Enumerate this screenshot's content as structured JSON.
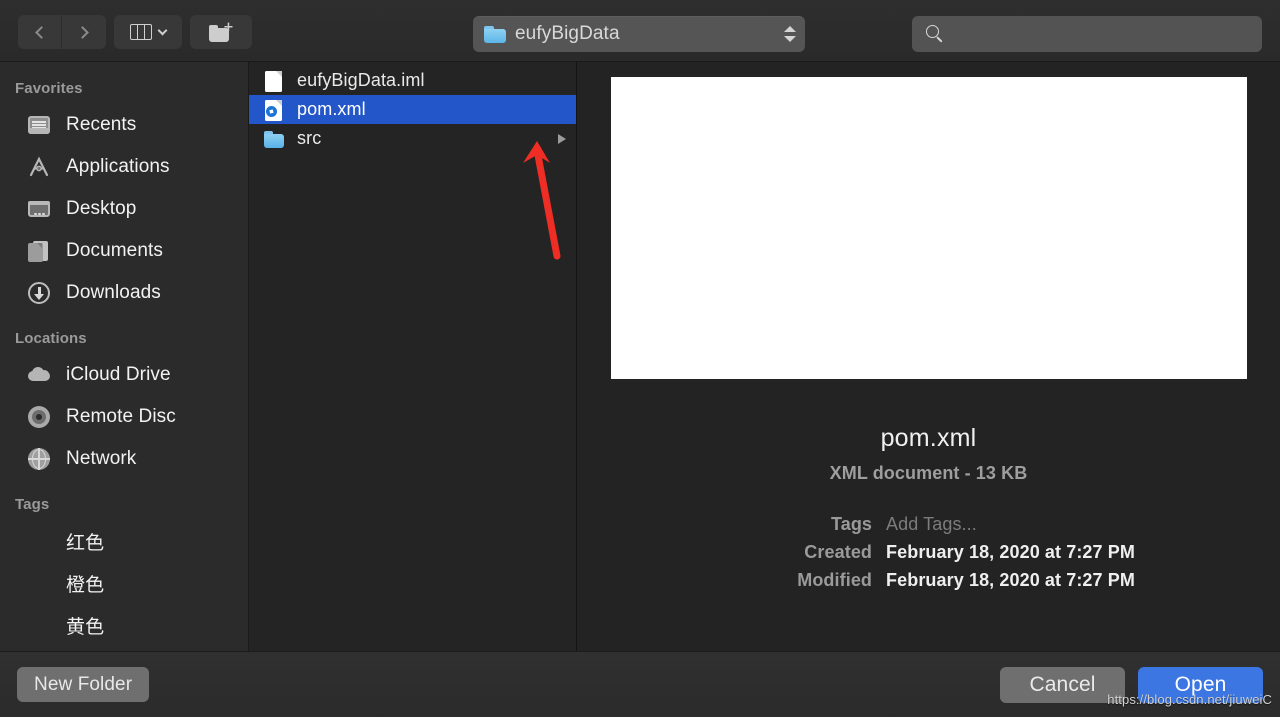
{
  "toolbar": {
    "back_label": "Back",
    "forward_label": "Forward",
    "view_label": "Column View",
    "new_folder_icon_label": "New Folder",
    "path_popup": {
      "label": "eufyBigData",
      "icon": "folder-icon"
    },
    "search": {
      "value": "",
      "placeholder": "",
      "icon": "search-icon"
    }
  },
  "sidebar": {
    "sections": [
      {
        "title": "Favorites",
        "items": [
          {
            "label": "Recents",
            "icon": "recents-icon"
          },
          {
            "label": "Applications",
            "icon": "applications-icon"
          },
          {
            "label": "Desktop",
            "icon": "desktop-icon"
          },
          {
            "label": "Documents",
            "icon": "documents-icon"
          },
          {
            "label": "Downloads",
            "icon": "downloads-icon"
          }
        ]
      },
      {
        "title": "Locations",
        "items": [
          {
            "label": "iCloud Drive",
            "icon": "icloud-icon"
          },
          {
            "label": "Remote Disc",
            "icon": "disc-icon"
          },
          {
            "label": "Network",
            "icon": "network-icon"
          }
        ]
      },
      {
        "title": "Tags",
        "items": [
          {
            "label": "红色",
            "icon": "tag-dot-icon",
            "color": "#ed6f62"
          },
          {
            "label": "橙色",
            "icon": "tag-dot-icon",
            "color": "#eda54e"
          },
          {
            "label": "黄色",
            "icon": "tag-dot-icon",
            "color": "#f2d65e"
          }
        ]
      }
    ]
  },
  "file_list": {
    "items": [
      {
        "name": "eufyBigData.iml",
        "icon": "document-icon",
        "selected": false,
        "has_children": false
      },
      {
        "name": "pom.xml",
        "icon": "xml-document-icon",
        "selected": true,
        "has_children": false
      },
      {
        "name": "src",
        "icon": "folder-icon",
        "selected": false,
        "has_children": true
      }
    ]
  },
  "preview": {
    "thumbnail": "blank-document-preview",
    "title": "pom.xml",
    "subtitle": "XML document - 13 KB",
    "metadata": [
      {
        "key": "Tags",
        "value": "Add Tags...",
        "placeholder": true
      },
      {
        "key": "Created",
        "value": "February 18, 2020 at 7:27 PM",
        "placeholder": false
      },
      {
        "key": "Modified",
        "value": "February 18, 2020 at 7:27 PM",
        "placeholder": false
      }
    ]
  },
  "footer": {
    "new_folder_label": "New Folder",
    "cancel_label": "Cancel",
    "open_label": "Open"
  },
  "annotation": {
    "arrow_color": "#ee2d24",
    "watermark": "https://blog.csdn.net/jiuweiC"
  },
  "colors": {
    "selection_blue": "#2356c9",
    "primary_button_blue": "#3b76e3",
    "window_bg": "#2b2b2b"
  }
}
